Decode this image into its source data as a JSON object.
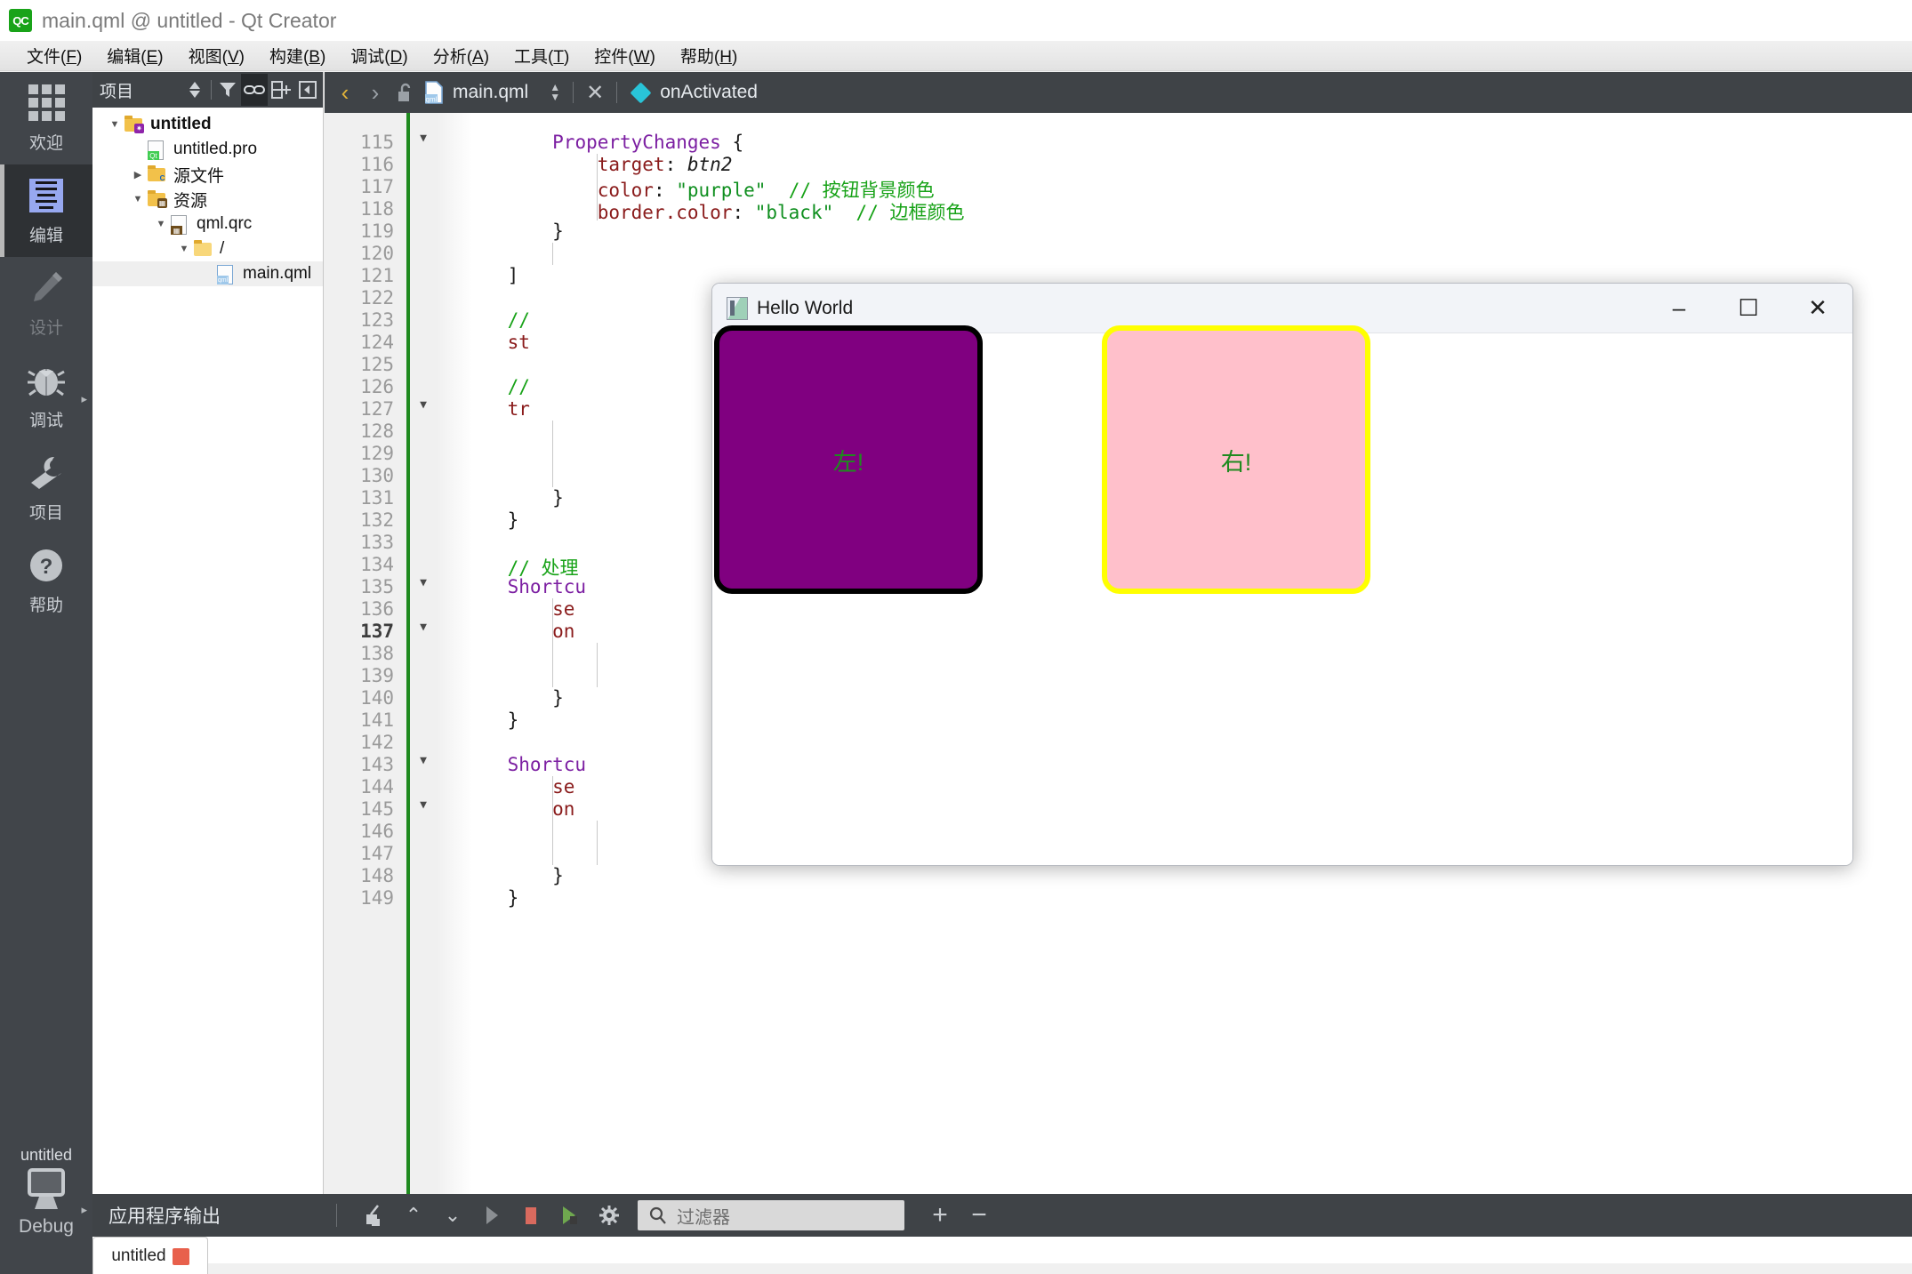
{
  "window": {
    "title": "main.qml @ untitled - Qt Creator",
    "logo_text": "QC"
  },
  "menubar": {
    "items": [
      {
        "label": "文件",
        "acc": "F"
      },
      {
        "label": "编辑",
        "acc": "E"
      },
      {
        "label": "视图",
        "acc": "V"
      },
      {
        "label": "构建",
        "acc": "B"
      },
      {
        "label": "调试",
        "acc": "D"
      },
      {
        "label": "分析",
        "acc": "A"
      },
      {
        "label": "工具",
        "acc": "T"
      },
      {
        "label": "控件",
        "acc": "W"
      },
      {
        "label": "帮助",
        "acc": "H"
      }
    ]
  },
  "modebar": {
    "modes": [
      {
        "label": "欢迎",
        "icon": "grid-icon",
        "state": "normal"
      },
      {
        "label": "编辑",
        "icon": "document-lines-icon",
        "state": "active"
      },
      {
        "label": "设计",
        "icon": "pencil-icon",
        "state": "disabled"
      },
      {
        "label": "调试",
        "icon": "bug-icon",
        "state": "normal"
      },
      {
        "label": "项目",
        "icon": "wrench-icon",
        "state": "normal"
      },
      {
        "label": "帮助",
        "icon": "question-circle-icon",
        "state": "normal"
      }
    ],
    "kit": {
      "project": "untitled",
      "config": "Debug",
      "icon": "monitor-icon"
    }
  },
  "project_panel": {
    "header_title": "项目",
    "buttons": [
      {
        "name": "sync-selector",
        "icon": "updown-arrows-icon"
      },
      {
        "name": "filter",
        "icon": "funnel-icon"
      },
      {
        "name": "link-with-editor",
        "icon": "link-icon",
        "active": true
      },
      {
        "name": "split",
        "icon": "split-add-icon"
      },
      {
        "name": "close-sidebar",
        "icon": "collapse-left-icon"
      }
    ],
    "tree": [
      {
        "label": "untitled",
        "icon": "project-folder-icon",
        "depth": 0,
        "twisty": "open",
        "bold": true,
        "selected": false
      },
      {
        "label": "untitled.pro",
        "icon": "qt-pro-file-icon",
        "depth": 1,
        "twisty": "none",
        "bold": false,
        "selected": false
      },
      {
        "label": "源文件",
        "icon": "cpp-folder-icon",
        "depth": 1,
        "twisty": "closed",
        "bold": false,
        "selected": false
      },
      {
        "label": "资源",
        "icon": "resource-folder-icon",
        "depth": 1,
        "twisty": "open",
        "bold": false,
        "selected": false
      },
      {
        "label": "qml.qrc",
        "icon": "qrc-file-icon",
        "depth": 2,
        "twisty": "open",
        "bold": false,
        "selected": false
      },
      {
        "label": "/",
        "icon": "plain-folder-icon",
        "depth": 3,
        "twisty": "open",
        "bold": false,
        "selected": false
      },
      {
        "label": "main.qml",
        "icon": "qml-file-icon",
        "depth": 4,
        "twisty": "none",
        "bold": false,
        "selected": true
      }
    ]
  },
  "editor": {
    "nav_back": "‹",
    "nav_forward": "›",
    "lock_icon": "unlocked-icon",
    "file_icon": "qml-file-icon",
    "filename": "main.qml",
    "close_label": "✕",
    "symbol_icon": "diamond-icon",
    "symbol": "onActivated",
    "current_line": 137,
    "lines": [
      {
        "n": 115,
        "fold": "open",
        "indent": [],
        "tokens": [
          {
            "t": "        ",
            "c": "pl"
          },
          {
            "t": "PropertyChanges",
            "c": "kw"
          },
          {
            "t": " {",
            "c": "pl"
          }
        ]
      },
      {
        "n": 116,
        "fold": "none",
        "indent": [
          12
        ],
        "tokens": [
          {
            "t": "            ",
            "c": "pl"
          },
          {
            "t": "target",
            "c": "prop"
          },
          {
            "t": ": ",
            "c": "pl"
          },
          {
            "t": "btn2",
            "c": "id-it"
          }
        ]
      },
      {
        "n": 117,
        "fold": "none",
        "indent": [
          12
        ],
        "tokens": [
          {
            "t": "            ",
            "c": "pl"
          },
          {
            "t": "color",
            "c": "prop"
          },
          {
            "t": ": ",
            "c": "pl"
          },
          {
            "t": "\"purple\"",
            "c": "str"
          },
          {
            "t": "  ",
            "c": "pl"
          },
          {
            "t": "// 按钮背景颜色",
            "c": "cmt"
          }
        ]
      },
      {
        "n": 118,
        "fold": "none",
        "indent": [
          12
        ],
        "tokens": [
          {
            "t": "            ",
            "c": "pl"
          },
          {
            "t": "border.color",
            "c": "prop"
          },
          {
            "t": ": ",
            "c": "pl"
          },
          {
            "t": "\"black\"",
            "c": "str"
          },
          {
            "t": "  ",
            "c": "pl"
          },
          {
            "t": "// 边框颜色",
            "c": "cmt"
          }
        ]
      },
      {
        "n": 119,
        "fold": "none",
        "indent": [],
        "tokens": [
          {
            "t": "        }",
            "c": "pl"
          }
        ]
      },
      {
        "n": 120,
        "fold": "none",
        "indent": [
          8
        ],
        "tokens": []
      },
      {
        "n": 121,
        "fold": "none",
        "indent": [],
        "tokens": [
          {
            "t": "    ]",
            "c": "pl"
          }
        ]
      },
      {
        "n": 122,
        "fold": "none",
        "indent": [],
        "tokens": []
      },
      {
        "n": 123,
        "fold": "none",
        "indent": [],
        "tokens": [
          {
            "t": "    ",
            "c": "pl"
          },
          {
            "t": "//",
            "c": "cmt"
          }
        ]
      },
      {
        "n": 124,
        "fold": "none",
        "indent": [],
        "tokens": [
          {
            "t": "    ",
            "c": "pl"
          },
          {
            "t": "st",
            "c": "prop"
          }
        ]
      },
      {
        "n": 125,
        "fold": "none",
        "indent": [],
        "tokens": []
      },
      {
        "n": 126,
        "fold": "none",
        "indent": [],
        "tokens": [
          {
            "t": "    ",
            "c": "pl"
          },
          {
            "t": "//",
            "c": "cmt"
          }
        ]
      },
      {
        "n": 127,
        "fold": "open",
        "indent": [],
        "tokens": [
          {
            "t": "    ",
            "c": "pl"
          },
          {
            "t": "tr",
            "c": "prop"
          }
        ]
      },
      {
        "n": 128,
        "fold": "none",
        "indent": [
          8
        ],
        "tokens": []
      },
      {
        "n": 129,
        "fold": "none",
        "indent": [
          8
        ],
        "tokens": []
      },
      {
        "n": 130,
        "fold": "none",
        "indent": [
          8
        ],
        "tokens": []
      },
      {
        "n": 131,
        "fold": "none",
        "indent": [],
        "tokens": [
          {
            "t": "        }",
            "c": "pl"
          }
        ]
      },
      {
        "n": 132,
        "fold": "none",
        "indent": [],
        "tokens": [
          {
            "t": "    }",
            "c": "pl"
          }
        ]
      },
      {
        "n": 133,
        "fold": "none",
        "indent": [],
        "tokens": []
      },
      {
        "n": 134,
        "fold": "none",
        "indent": [],
        "tokens": [
          {
            "t": "    ",
            "c": "pl"
          },
          {
            "t": "// 处理",
            "c": "cmt"
          }
        ]
      },
      {
        "n": 135,
        "fold": "open",
        "indent": [],
        "tokens": [
          {
            "t": "    ",
            "c": "pl"
          },
          {
            "t": "Shortcu",
            "c": "kw"
          }
        ]
      },
      {
        "n": 136,
        "fold": "none",
        "indent": [
          8
        ],
        "tokens": [
          {
            "t": "        ",
            "c": "pl"
          },
          {
            "t": "se",
            "c": "prop"
          }
        ]
      },
      {
        "n": 137,
        "fold": "open",
        "indent": [
          8
        ],
        "tokens": [
          {
            "t": "        ",
            "c": "pl"
          },
          {
            "t": "on",
            "c": "prop"
          }
        ]
      },
      {
        "n": 138,
        "fold": "none",
        "indent": [
          8,
          12
        ],
        "tokens": []
      },
      {
        "n": 139,
        "fold": "none",
        "indent": [
          8,
          12
        ],
        "tokens": []
      },
      {
        "n": 140,
        "fold": "none",
        "indent": [],
        "tokens": [
          {
            "t": "        }",
            "c": "pl"
          }
        ]
      },
      {
        "n": 141,
        "fold": "none",
        "indent": [],
        "tokens": [
          {
            "t": "    }",
            "c": "pl"
          }
        ]
      },
      {
        "n": 142,
        "fold": "none",
        "indent": [],
        "tokens": []
      },
      {
        "n": 143,
        "fold": "open",
        "indent": [],
        "tokens": [
          {
            "t": "    ",
            "c": "pl"
          },
          {
            "t": "Shortcu",
            "c": "kw"
          }
        ]
      },
      {
        "n": 144,
        "fold": "none",
        "indent": [
          8
        ],
        "tokens": [
          {
            "t": "        ",
            "c": "pl"
          },
          {
            "t": "se",
            "c": "prop"
          }
        ]
      },
      {
        "n": 145,
        "fold": "open",
        "indent": [
          8
        ],
        "tokens": [
          {
            "t": "        ",
            "c": "pl"
          },
          {
            "t": "on",
            "c": "prop"
          }
        ]
      },
      {
        "n": 146,
        "fold": "none",
        "indent": [
          8,
          12
        ],
        "tokens": []
      },
      {
        "n": 147,
        "fold": "none",
        "indent": [
          8,
          12
        ],
        "tokens": []
      },
      {
        "n": 148,
        "fold": "none",
        "indent": [],
        "tokens": [
          {
            "t": "        }",
            "c": "pl"
          }
        ]
      },
      {
        "n": 149,
        "fold": "none",
        "indent": [],
        "tokens": [
          {
            "t": "    }",
            "c": "pl"
          }
        ]
      }
    ]
  },
  "hello_window": {
    "title": "Hello World",
    "icon": "app-window-icon",
    "controls": [
      {
        "name": "minimize-button",
        "glyph": "–"
      },
      {
        "name": "maximize-button",
        "glyph": "☐"
      },
      {
        "name": "close-button",
        "glyph": "✕"
      }
    ],
    "buttons": [
      {
        "name": "left-button",
        "label": "左!",
        "fill": "#800080",
        "border": "#000000",
        "text_color": "#1f8a1f"
      },
      {
        "name": "right-button",
        "label": "右!",
        "fill": "#FFC0CB",
        "border": "#FFFF00",
        "text_color": "#1f8a1f"
      }
    ]
  },
  "output_pane": {
    "title": "应用程序输出",
    "buttons": [
      {
        "name": "clear-output-button",
        "icon": "broom-icon"
      },
      {
        "name": "prev-item-button",
        "icon": "chevron-up-icon"
      },
      {
        "name": "next-item-button",
        "icon": "chevron-down-icon"
      },
      {
        "name": "run-button",
        "icon": "play-icon"
      },
      {
        "name": "stop-button",
        "icon": "stop-square-icon"
      },
      {
        "name": "attach-debugger-button",
        "icon": "run-debug-icon"
      },
      {
        "name": "settings-button",
        "icon": "gear-icon"
      }
    ],
    "filter_placeholder": "过滤器",
    "zoom_in": "+",
    "zoom_out": "−",
    "tab_label": "untitled"
  }
}
